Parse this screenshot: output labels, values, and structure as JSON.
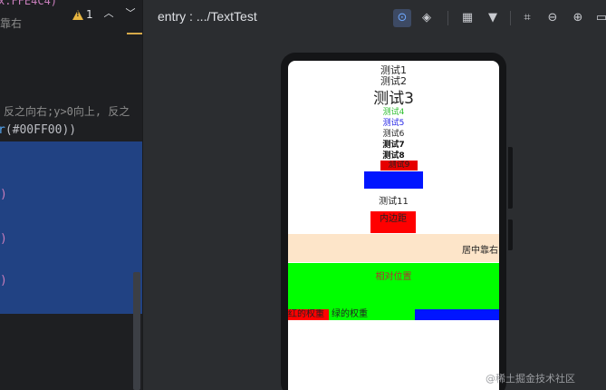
{
  "editor": {
    "top_fragment": "x.FFE4C4)",
    "sub_fragment": "靠右",
    "warning_count": "1",
    "comment_fragment": "反之向右;y>0向上, 反之",
    "color_fragment_fn": "r",
    "color_fragment_arg": "(#00FF00))",
    "paren_1": ")",
    "paren_2": ")",
    "paren_3": ")"
  },
  "preview": {
    "title": "entry : .../TextTest",
    "toolbar": {
      "inspect_icon": "inspect-icon",
      "layers_icon": "layers-icon",
      "grid_icon": "grid-icon",
      "dropdown_icon": "chevron-down-icon",
      "crop_icon": "crop-icon",
      "zoom_out_icon": "zoom-out-icon",
      "zoom_in_icon": "zoom-in-icon",
      "more_icon": "more-icon"
    },
    "screen": {
      "text1": "测试1",
      "text2": "测试2",
      "text3": "测试3",
      "text4": "测试4",
      "text5": "测试5",
      "text6": "测试6",
      "text7": "测试7",
      "text8": "测试8",
      "text9": "测试9",
      "text11": "测试11",
      "padding_label": "内边距",
      "center_right_label": "居中靠右",
      "relative_position_label": "相对位置",
      "red_weight_label": "红的权重",
      "green_weight_label": "绿的权重"
    },
    "colors": {
      "green": "#00FF00",
      "red": "#FF0000",
      "blue": "#0015FF",
      "bisque": "#FFE4C4"
    }
  },
  "watermark": "@稀土掘金技术社区"
}
